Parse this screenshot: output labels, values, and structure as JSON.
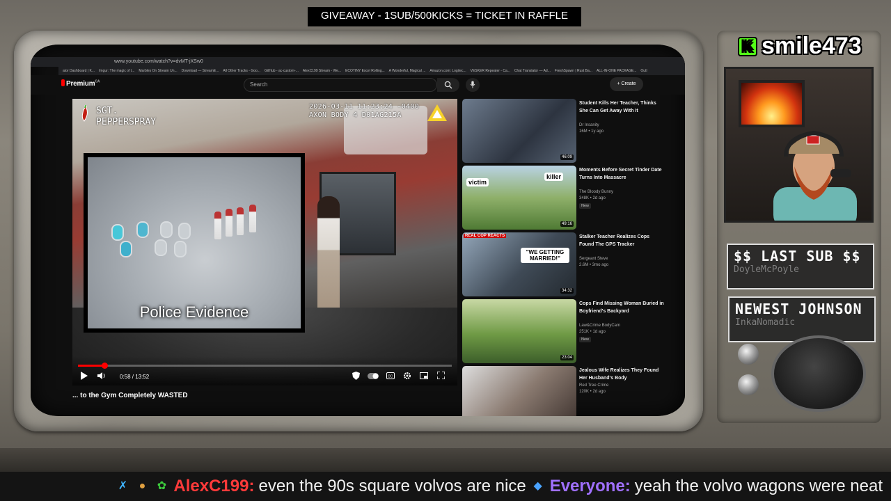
{
  "banner": {
    "giveaway_text": "GIVEAWAY - 1SUB/500KICKS = TICKET IN RAFFLE"
  },
  "browser": {
    "url": "www.youtube.com/watch?v=dvMT-jXSw0",
    "bookmarks": [
      "ator Dashboard | K...",
      "Imgur: The magic of t...",
      "Marbles On Stream Un...",
      "Download — StreamE...",
      "All Other Tracks - Goo...",
      "GitHub - ac-custom-...",
      "AlexC199 Stream - We...",
      "ECOTINY Excel Rolling...",
      "A Wonderful, Magical ...",
      "Amazon.com: Logitec...",
      "VESKER Repeater - Ca...",
      "Chat Translator — Ad...",
      "FreshSpawn | Rust Ba...",
      "ALL-IN-ONE PACKAGE...",
      "Outl"
    ]
  },
  "youtube": {
    "logo_text": "Premium",
    "logo_sup": "CA",
    "search_placeholder": "Search",
    "create_label": "+ Create"
  },
  "video": {
    "channel_overlay_line1": "SGT.",
    "channel_overlay_line2": "PEPPERSPRAY",
    "timestamp_line1": "2026-03-11 11:23:24 -0400",
    "timestamp_line2": "AXON BODY 4 D01AG215A",
    "evidence_caption": "Police Evidence",
    "time_display": "0:58 / 13:52",
    "progress_fraction": 0.07,
    "title": "... to the Gym Completely WASTED"
  },
  "recommendations": [
    {
      "title": "Student Kills Her Teacher, Thinks She Can Get Away With It",
      "channel": "Dr Insanity",
      "meta": "16M • 1y ago",
      "duration": "46:09",
      "new": ""
    },
    {
      "title": "Moments Before Secret Tinder Date Turns Into Massacre",
      "channel": "The Bloody Bunny",
      "meta": "348K • 2d ago",
      "duration": "49:16",
      "new": "New",
      "labels": [
        "victim",
        "killer"
      ]
    },
    {
      "title": "Stalker Teacher Realizes Cops Found The GPS Tracker",
      "channel": "Sergeant Steve",
      "meta": "2.6M • 3mo ago",
      "duration": "34:32",
      "new": "",
      "thumb_text": "\"WE GETTING MARRIED!\"",
      "thumb_badge": "REAL COP REACTS"
    },
    {
      "title": "Cops Find Missing Woman Buried in Boyfriend's Backyard",
      "channel": "Law&Crime BodyCam",
      "meta": "251K • 1d ago",
      "duration": "23:04",
      "new": "New"
    },
    {
      "title": "Jealous Wife Realizes They Found Her Husband's Body",
      "channel": "Red Tree Crime",
      "meta": "120K • 2d ago",
      "duration": "",
      "new": ""
    }
  ],
  "streamer": {
    "name": "smile473",
    "platform_icon": "kick-logo-icon",
    "last_sub_title": "$$ LAST SUB $$",
    "last_sub_value": "DoyleMcPoyle",
    "newest_title": "NEWEST JOHNSON",
    "newest_value": "InkaNomadic"
  },
  "chat": [
    {
      "user": "AlexC199:",
      "user_color": "#ff3a3a",
      "message": "even the 90s square volvos are nice",
      "badges": [
        "sword-icon",
        "burger-icon",
        "recycle-icon"
      ]
    },
    {
      "user": "Everyone:",
      "user_color": "#a070ff",
      "message": "yeah the volvo wagons were neat",
      "badges": [
        "cube-icon"
      ]
    }
  ],
  "colors": {
    "accent_red": "#ff0000",
    "kick_green": "#53fc18"
  }
}
